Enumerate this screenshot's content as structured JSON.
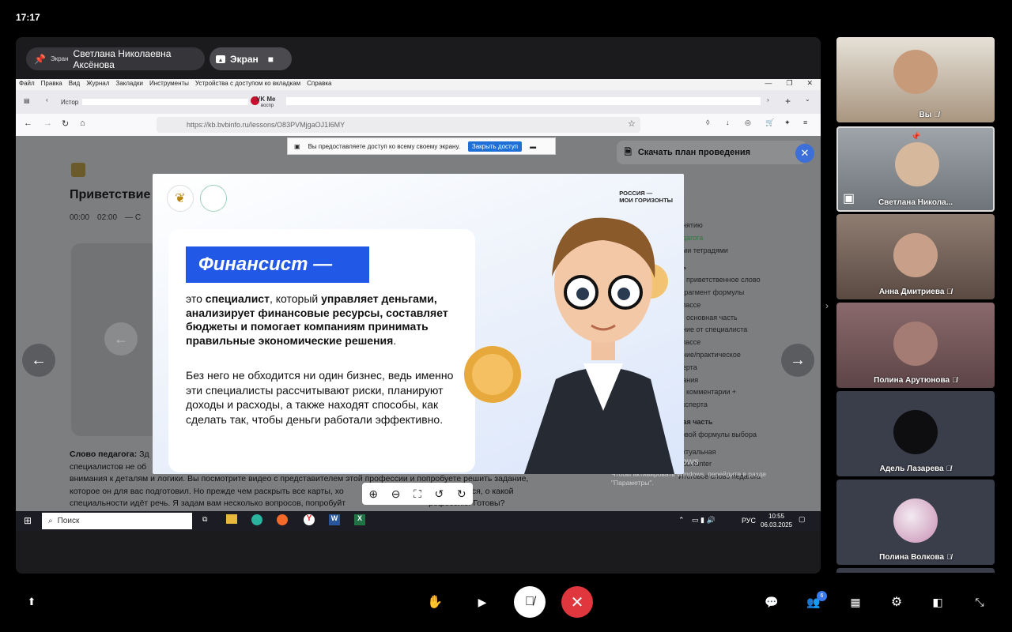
{
  "status": {
    "time": "17:17"
  },
  "stage": {
    "speaker_small": "Экран",
    "speaker_name": "Светлана Николаевна Аксёнова",
    "screen_label": "Экран"
  },
  "browser": {
    "menu": [
      "Файл",
      "Правка",
      "Вид",
      "Журнал",
      "Закладки",
      "Инструменты",
      "Устройства с доступом ко вкладкам",
      "Справка"
    ],
    "tab_text": "Истор",
    "tab_text2": "VK Ме",
    "tab_text3": "воспр",
    "url": "https://kb.bvbinfo.ru/lessons/O83PVMjgaOJ1I6MY",
    "share_notice": "Вы предоставляете доступ ко всему своему экрану.",
    "share_notice_button": "Закрыть доступ"
  },
  "page": {
    "title_partial": "Приветствие",
    "time_a": "00:00",
    "time_b": "02:00",
    "time_c": "— С",
    "download_plan": "Скачать план проведения",
    "teacher_label": "Слово педагога:",
    "teacher_text_start": "Зд",
    "body_lines": [
      "специалистов не об",
      "внимания к деталям и логики. Вы посмотрите видео с представителем этой профессии и попробуете решить задание,",
      "которое он для вас подготовил. Но прежде чем раскрыть все карты, хо",
      "специальности идёт речь. Я задам вам несколько вопросов, попробуйт"
    ],
    "body_tail_1": "и догадаться, о какой",
    "body_tail_2": "рофессию! Готовы?",
    "right_items": [
      "онятию",
      "едагога",
      "ими тетрадями",
      "ть",
      "1: приветственное слово",
      "фрагмент формулы",
      "классе",
      "2: основная часть",
      "ание от специалиста",
      "классе",
      "ание/практическое",
      "перта",
      "дания",
      "3: комментарии +",
      "эксперта",
      "ная часть",
      "говой формулы выбора",
      "актуальная",
      "eadHunter",
      "Итоговое слово педагога"
    ],
    "watermark_1": "Активация Windows",
    "watermark_2": "Чтобы активировать Windows, перейдите в разде",
    "watermark_3": "\"Параметры\"."
  },
  "slide": {
    "tag_line1": "РОССИЯ —",
    "tag_line2": "МОИ ГОРИЗОНТЫ",
    "title": "Финансист —",
    "p1_a": "это ",
    "p1_b": "специалист",
    "p1_c": ", который ",
    "p1_d": "управляет деньгами, анализирует финансовые ресурсы, составляет бюджеты и помогает компаниям принимать правильные экономические решения",
    "p1_e": ".",
    "p2": "Без него не обходится ни один бизнес, ведь именно эти специалисты рассчитывают риски, планируют доходы и расходы, а также находят способы, как сделать так, чтобы деньги работали эффективно."
  },
  "taskbar": {
    "search": "Поиск",
    "lang": "РУС",
    "time": "10:55",
    "date": "06.03.2025"
  },
  "participants": [
    {
      "name": "Вы",
      "muted": true,
      "color": "#b8a893"
    },
    {
      "name": "Светлана Никола...",
      "muted": false,
      "color": "#8c8f93"
    },
    {
      "name": "Анна Дмитриева",
      "muted": true,
      "color": "#7b6a60"
    },
    {
      "name": "Полина Арутюнова",
      "muted": true,
      "color": "#7a5a5e"
    },
    {
      "name": "Адель Лазарева",
      "muted": true,
      "color": "#3a3d4a"
    },
    {
      "name": "Полина Волкова",
      "muted": true,
      "color": "#3a3d4a"
    }
  ],
  "controls": {
    "participants_count": "6"
  },
  "colors": {
    "accent": "#2158e6",
    "end_call": "#e0363e",
    "badge": "#3a7bf0"
  }
}
